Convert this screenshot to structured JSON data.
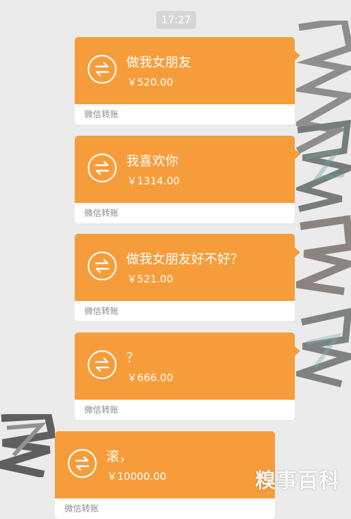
{
  "time_badge": "17:27",
  "transfers": [
    {
      "message": "做我女朋友",
      "amount": "￥520.00",
      "footer": "微信转账"
    },
    {
      "message": "我喜欢你",
      "amount": "￥1314.00",
      "footer": "微信转账"
    },
    {
      "message": "做我女朋友好不好？",
      "amount": "￥521.00",
      "footer": "微信转账"
    },
    {
      "message": "？",
      "amount": "￥666.00",
      "footer": "微信转账"
    },
    {
      "message": "滚，",
      "amount": "￥10000.00",
      "footer": "微信转账"
    }
  ],
  "icons": [
    "transfer-arrows-icon",
    "redacted-avatar-icon"
  ],
  "colors": {
    "background": "#ebebeb",
    "card_orange": "#f79c3a",
    "card_footer": "#ffffff",
    "footer_text": "#8a8a8a",
    "time_badge": "#d6d6d6"
  },
  "watermark": "糗事百科"
}
